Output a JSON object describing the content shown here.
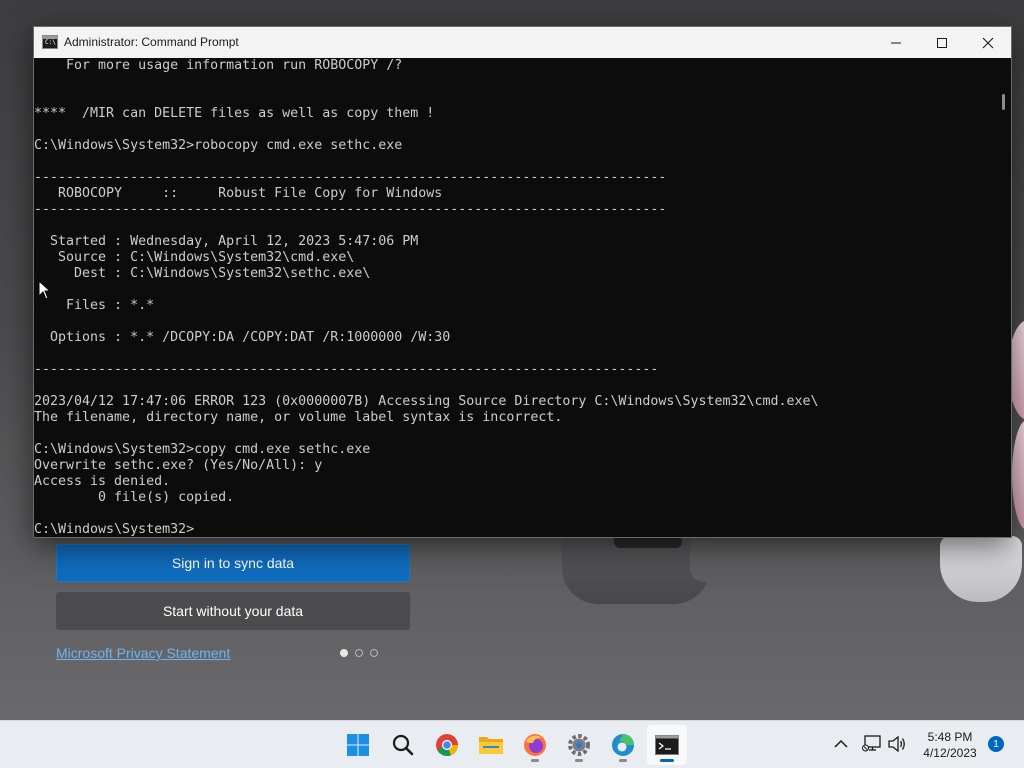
{
  "window": {
    "title": "Administrator: Command Prompt",
    "icon_name": "cmd-icon",
    "icon_text": "C:\\",
    "buttons": {
      "minimize": "minimize-icon",
      "maximize": "maximize-icon",
      "close": "close-icon"
    }
  },
  "console": {
    "lines": [
      "    For more usage information run ROBOCOPY /?",
      "",
      "",
      "****  /MIR can DELETE files as well as copy them !",
      "",
      "C:\\Windows\\System32>robocopy cmd.exe sethc.exe",
      "",
      "-------------------------------------------------------------------------------",
      "   ROBOCOPY     ::     Robust File Copy for Windows",
      "-------------------------------------------------------------------------------",
      "",
      "  Started : Wednesday, April 12, 2023 5:47:06 PM",
      "   Source : C:\\Windows\\System32\\cmd.exe\\",
      "     Dest : C:\\Windows\\System32\\sethc.exe\\",
      "",
      "    Files : *.*",
      "",
      "  Options : *.* /DCOPY:DA /COPY:DAT /R:1000000 /W:30",
      "",
      "------------------------------------------------------------------------------",
      "",
      "2023/04/12 17:47:06 ERROR 123 (0x0000007B) Accessing Source Directory C:\\Windows\\System32\\cmd.exe\\",
      "The filename, directory name, or volume label syntax is incorrect.",
      "",
      "C:\\Windows\\System32>copy cmd.exe sethc.exe",
      "Overwrite sethc.exe? (Yes/No/All): y",
      "Access is denied.",
      "        0 file(s) copied.",
      "",
      "C:\\Windows\\System32>"
    ]
  },
  "oobe": {
    "sign_in_label": "Sign in to sync data",
    "start_without_label": "Start without your data",
    "privacy_link": "Microsoft Privacy Statement",
    "pager_count": 3,
    "pager_active_index": 0
  },
  "taskbar": {
    "apps": [
      {
        "name": "start-button",
        "icon": "windows-logo-icon",
        "running": false,
        "active": false
      },
      {
        "name": "search-button",
        "icon": "search-icon",
        "running": false,
        "active": false
      },
      {
        "name": "chrome-button",
        "icon": "chrome-icon",
        "running": false,
        "active": false
      },
      {
        "name": "file-explorer-button",
        "icon": "folder-icon",
        "running": false,
        "active": false
      },
      {
        "name": "firefox-button",
        "icon": "firefox-icon",
        "running": true,
        "active": false
      },
      {
        "name": "settings-button",
        "icon": "gear-icon",
        "running": true,
        "active": false
      },
      {
        "name": "edge-button",
        "icon": "edge-icon",
        "running": true,
        "active": false
      },
      {
        "name": "command-prompt-button",
        "icon": "terminal-icon",
        "running": true,
        "active": true
      }
    ],
    "tray": {
      "chevron": "chevron-up-icon",
      "network": "network-icon",
      "volume": "volume-icon",
      "time": "5:48 PM",
      "date": "4/12/2023",
      "notification_count": "1"
    }
  },
  "colors": {
    "console_bg": "#0c0c0c",
    "console_fg": "#cccccc",
    "accent": "#0067c0",
    "oobe_button": "#0f6cbd"
  }
}
